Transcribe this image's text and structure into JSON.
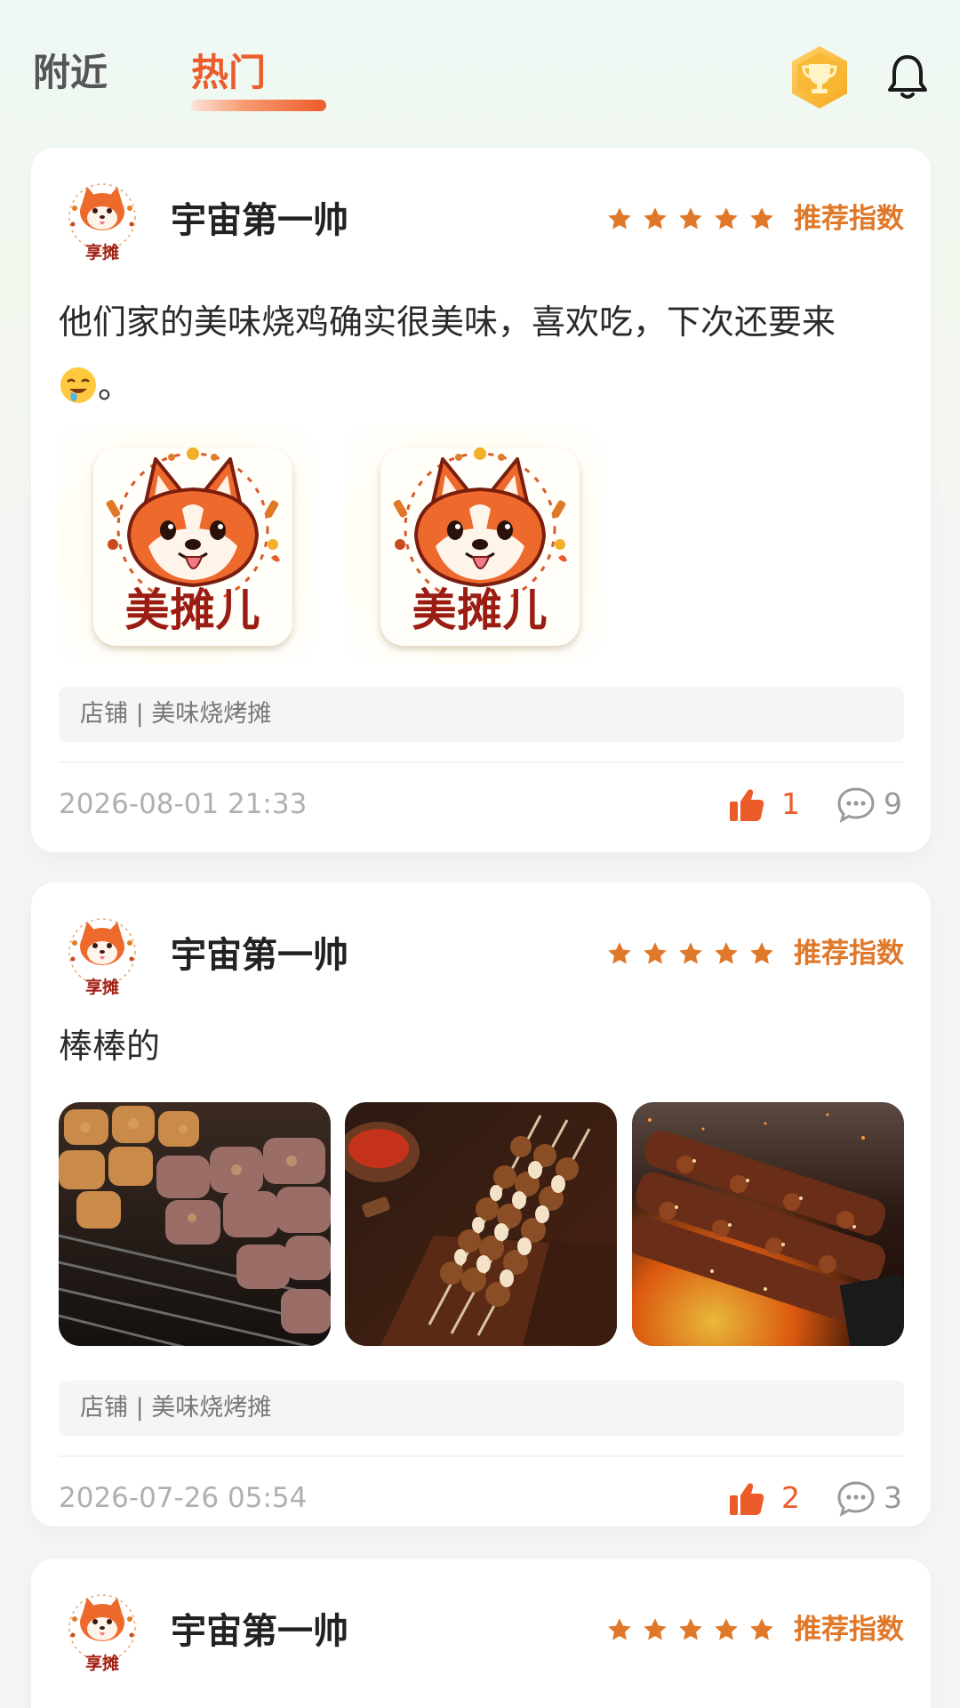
{
  "tabs": {
    "nearby": "附近",
    "hot": "热门"
  },
  "colors": {
    "accent": "#ec5b2a",
    "star": "#e0782a",
    "rec_label": "#e0782a"
  },
  "icons": {
    "trophy": "trophy-badge-icon",
    "bell": "bell-icon",
    "star": "star-icon",
    "like": "thumbs-up-icon",
    "comment": "comment-bubble-icon"
  },
  "posts": [
    {
      "user": "宇宙第一帅",
      "avatar_text": "享摊",
      "rating": 5,
      "rating_label": "推荐指数",
      "text": "他们家的美味烧鸡确实很美味，喜欢吃，下次还要来",
      "text_suffix": "。",
      "images": [
        {
          "kind": "logo",
          "text": "美摊儿"
        },
        {
          "kind": "logo",
          "text": "美摊儿"
        }
      ],
      "shop": "店铺 | 美味烧烤摊",
      "time": "2026-08-01 21:33",
      "likes": "1",
      "comments": "9"
    },
    {
      "user": "宇宙第一帅",
      "avatar_text": "享摊",
      "rating": 5,
      "rating_label": "推荐指数",
      "text": "棒棒的",
      "images": [
        {
          "kind": "photo",
          "subject": "grilled meat skewers"
        },
        {
          "kind": "photo",
          "subject": "skewers on wooden board"
        },
        {
          "kind": "photo",
          "subject": "skewers over fire"
        }
      ],
      "shop": "店铺 | 美味烧烤摊",
      "time": "2026-07-26 05:54",
      "likes": "2",
      "comments": "3"
    },
    {
      "user": "宇宙第一帅",
      "avatar_text": "享摊",
      "rating": 5,
      "rating_label": "推荐指数"
    }
  ]
}
